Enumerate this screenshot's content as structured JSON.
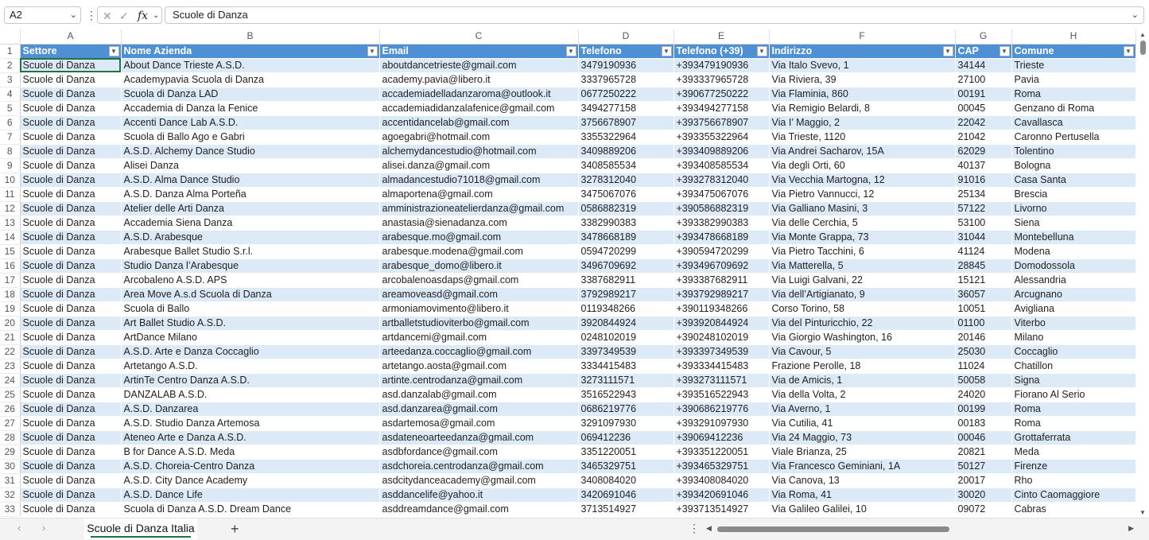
{
  "formula_bar": {
    "name_box": "A2",
    "cancel_icon": "✕",
    "enter_icon": "✓",
    "fx_label": "fx",
    "formula": "Scuole di Danza"
  },
  "columns": [
    "A",
    "B",
    "C",
    "D",
    "E",
    "F",
    "G",
    "H"
  ],
  "column_widths": [
    127,
    325,
    250,
    120,
    120,
    234,
    71,
    156
  ],
  "headers": [
    "Settore",
    "Nome Azienda",
    "Email",
    "Telefono",
    "Telefono (+39)",
    "Indirizzo",
    "CAP",
    "Comune"
  ],
  "rows": [
    [
      "Scuole di Danza",
      "About Dance Trieste A.S.D.",
      "aboutdancetrieste@gmail.com",
      "3479190936",
      "+393479190936",
      "Via Italo Svevo, 1",
      "34144",
      "Trieste"
    ],
    [
      "Scuole di Danza",
      "Academypavia Scuola di Danza",
      "academy.pavia@libero.it",
      "3337965728",
      "+393337965728",
      "Via Riviera, 39",
      "27100",
      "Pavia"
    ],
    [
      "Scuole di Danza",
      "Scuola di Danza LAD",
      "accademiadelladanzaroma@outlook.it",
      "0677250222",
      "+390677250222",
      "Via Flaminia, 860",
      "00191",
      "Roma"
    ],
    [
      "Scuole di Danza",
      "Accademia di Danza la Fenice",
      "accademiadidanzalafenice@gmail.com",
      "3494277158",
      "+393494277158",
      "Via Remigio Belardi, 8",
      "00045",
      "Genzano di Roma"
    ],
    [
      "Scuole di Danza",
      "Accenti Dance Lab A.S.D.",
      "accentidancelab@gmail.com",
      "3756678907",
      "+393756678907",
      "Via I’ Maggio, 2",
      "22042",
      "Cavallasca"
    ],
    [
      "Scuole di Danza",
      "Scuola di Ballo Ago e Gabri",
      "agoegabri@hotmail.com",
      "3355322964",
      "+393355322964",
      "Via Trieste, 1120",
      "21042",
      "Caronno Pertusella"
    ],
    [
      "Scuole di Danza",
      "A.S.D. Alchemy Dance Studio",
      "alchemydancestudio@hotmail.com",
      "3409889206",
      "+393409889206",
      "Via Andrei Sacharov, 15A",
      "62029",
      "Tolentino"
    ],
    [
      "Scuole di Danza",
      "Alisei Danza",
      "alisei.danza@gmail.com",
      "3408585534",
      "+393408585534",
      "Via degli Orti, 60",
      "40137",
      "Bologna"
    ],
    [
      "Scuole di Danza",
      "A.S.D. Alma Dance Studio",
      "almadancestudio71018@gmail.com",
      "3278312040",
      "+393278312040",
      "Via Vecchia Martogna, 12",
      "91016",
      "Casa Santa"
    ],
    [
      "Scuole di Danza",
      "A.S.D. Danza Alma Porteña",
      "almaportena@gmail.com",
      "3475067076",
      "+393475067076",
      "Via Pietro Vannucci, 12",
      "25134",
      "Brescia"
    ],
    [
      "Scuole di Danza",
      "Atelier delle Arti Danza",
      "amministrazioneatelierdanza@gmail.com",
      "0586882319",
      "+390586882319",
      "Via Galliano Masini, 3",
      "57122",
      "Livorno"
    ],
    [
      "Scuole di Danza",
      "Accademia Siena Danza",
      "anastasia@sienadanza.com",
      "3382990383",
      "+393382990383",
      "Via delle Cerchia, 5",
      "53100",
      "Siena"
    ],
    [
      "Scuole di Danza",
      "A.S.D. Arabesque",
      "arabesque.mo@gmail.com",
      "3478668189",
      "+393478668189",
      "Via Monte Grappa, 73",
      "31044",
      "Montebelluna"
    ],
    [
      "Scuole di Danza",
      "Arabesque Ballet Studio S.r.l.",
      "arabesque.modena@gmail.com",
      "0594720299",
      "+390594720299",
      "Via Pietro Tacchini, 6",
      "41124",
      "Modena"
    ],
    [
      "Scuole di Danza",
      "Studio Danza l’Arabesque",
      "arabesque_domo@libero.it",
      "3496709692",
      "+393496709692",
      "Via Matterella, 5",
      "28845",
      "Domodossola"
    ],
    [
      "Scuole di Danza",
      "Arcobaleno A.S.D. APS",
      "arcobalenoasdaps@gmail.com",
      "3387682911",
      "+393387682911",
      "Via Luigi Galvani, 22",
      "15121",
      "Alessandria"
    ],
    [
      "Scuole di Danza",
      "Area Move A.s.d Scuola di Danza",
      "areamoveasd@gmail.com",
      "3792989217",
      "+393792989217",
      "Via dell’Artigianato, 9",
      "36057",
      "Arcugnano"
    ],
    [
      "Scuole di Danza",
      "Scuola di Ballo",
      "armoniamovimento@libero.it",
      "0119348266",
      "+390119348266",
      "Corso Torino, 58",
      "10051",
      "Avigliana"
    ],
    [
      "Scuole di Danza",
      "Art Ballet Studio A.S.D.",
      "artballetstudioviterbo@gmail.com",
      "3920844924",
      "+393920844924",
      "Via del Pinturicchio, 22",
      "01100",
      "Viterbo"
    ],
    [
      "Scuole di Danza",
      "ArtDance Milano",
      "artdancemi@gmail.com",
      "0248102019",
      "+390248102019",
      "Via Giorgio Washington, 16",
      "20146",
      "Milano"
    ],
    [
      "Scuole di Danza",
      "A.S.D. Arte e Danza Coccaglio",
      "arteedanza.coccaglio@gmail.com",
      "3397349539",
      "+393397349539",
      "Via Cavour, 5",
      "25030",
      "Coccaglio"
    ],
    [
      "Scuole di Danza",
      "Artetango A.S.D.",
      "artetango.aosta@gmail.com",
      "3334415483",
      "+393334415483",
      "Frazione Perolle, 18",
      "11024",
      "Chatillon"
    ],
    [
      "Scuole di Danza",
      "ArtinTe Centro Danza A.S.D.",
      "artinte.centrodanza@gmail.com",
      "3273111571",
      "+393273111571",
      "Via de Amicis, 1",
      "50058",
      "Signa"
    ],
    [
      "Scuole di Danza",
      "DANZALAB A.S.D.",
      "asd.danzalab@gmail.com",
      "3516522943",
      "+393516522943",
      "Via della Volta, 2",
      "24020",
      "Fiorano Al Serio"
    ],
    [
      "Scuole di Danza",
      "A.S.D. Danzarea",
      "asd.danzarea@gmail.com",
      "0686219776",
      "+390686219776",
      "Via Averno, 1",
      "00199",
      "Roma"
    ],
    [
      "Scuole di Danza",
      "A.S.D. Studio Danza Artemosa",
      "asdartemosa@gmail.com",
      "3291097930",
      "+393291097930",
      "Via Cutilia, 41",
      "00183",
      "Roma"
    ],
    [
      "Scuole di Danza",
      "Ateneo Arte e Danza A.S.D.",
      "asdateneoarteedanza@gmail.com",
      "069412236",
      "+39069412236",
      "Via 24 Maggio, 73",
      "00046",
      "Grottaferrata"
    ],
    [
      "Scuole di Danza",
      "B for Dance A.S.D. Meda",
      "asdbfordance@gmail.com",
      "3351220051",
      "+393351220051",
      "Viale Brianza, 25",
      "20821",
      "Meda"
    ],
    [
      "Scuole di Danza",
      "A.S.D. Choreia-Centro Danza",
      "asdchoreia.centrodanza@gmail.com",
      "3465329751",
      "+393465329751",
      "Via Francesco Geminiani, 1A",
      "50127",
      "Firenze"
    ],
    [
      "Scuole di Danza",
      "A.S.D. City Dance Academy",
      "asdcitydanceacademy@gmail.com",
      "3408084020",
      "+393408084020",
      "Via Canova, 13",
      "20017",
      "Rho"
    ],
    [
      "Scuole di Danza",
      "A.S.D. Dance Life",
      "asddancelife@yahoo.it",
      "3420691046",
      "+393420691046",
      "Via Roma, 41",
      "30020",
      "Cinto Caomaggiore"
    ],
    [
      "Scuole di Danza",
      "Scuola di Danza A.S.D. Dream Dance",
      "asddreamdance@gmail.com",
      "3713514927",
      "+393713514927",
      "Via Galileo Galilei, 10",
      "09072",
      "Cabras"
    ]
  ],
  "footer": {
    "sheet_tab": "Scuole di Danza Italia",
    "add_sheet": "+",
    "nav_prev": "‹",
    "nav_next": "›"
  },
  "colors": {
    "header_fill": "#4f8fd4",
    "band_fill": "#dce9f7",
    "accent_green": "#217346"
  }
}
